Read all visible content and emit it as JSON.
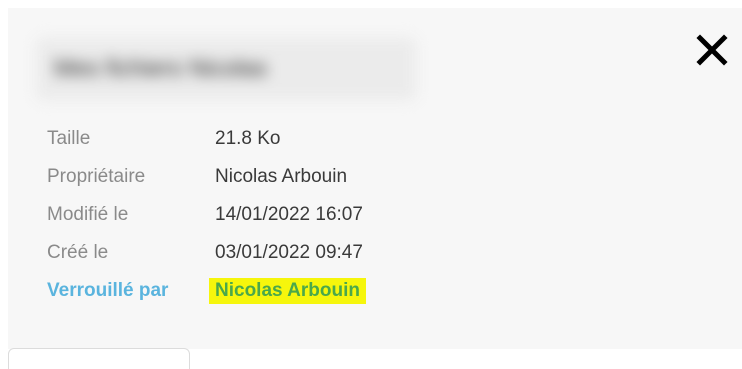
{
  "header": {
    "blurred_title": "Mes fichiers Nicolas",
    "close_icon": "close-icon"
  },
  "details": {
    "size_label": "Taille",
    "size_value": "21.8 Ko",
    "owner_label": "Propriétaire",
    "owner_value": "Nicolas Arbouin",
    "modified_label": "Modifié le",
    "modified_value": "14/01/2022 16:07",
    "created_label": "Créé le",
    "created_value": "03/01/2022 09:47",
    "locked_label": "Verrouillé par",
    "locked_value": "Nicolas Arbouin"
  },
  "colors": {
    "panel_background": "#f7f7f7",
    "label": "#8a8a8a",
    "value": "#3a3a3a",
    "locked_label": "#5ab4de",
    "locked_value": "#4aa84b",
    "highlight": "#f6f60c"
  }
}
